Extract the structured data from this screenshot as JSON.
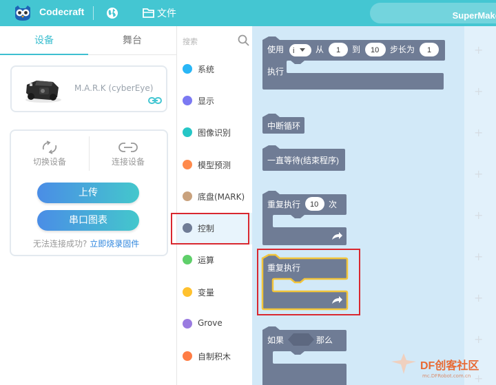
{
  "header": {
    "app_title": "Codecraft",
    "file_menu": "文件",
    "project_name": "SuperMaker",
    "bg_color": "#44c6d2"
  },
  "left_panel": {
    "tabs": [
      {
        "label": "设备",
        "active": true
      },
      {
        "label": "舞台",
        "active": false
      }
    ],
    "device": {
      "name": "M.A.R.K (cyberEye)"
    },
    "connection": {
      "switch_label": "切换设备",
      "connect_label": "连接设备",
      "upload_label": "上传",
      "serial_chart_label": "串口图表",
      "fail_text": "无法连接成功?",
      "flash_link": "立即烧录固件"
    }
  },
  "categories": {
    "search_placeholder": "搜索",
    "items": [
      {
        "label": "系统",
        "color": "#29b6f6"
      },
      {
        "label": "显示",
        "color": "#7b79f2"
      },
      {
        "label": "图像识别",
        "color": "#26c6c6"
      },
      {
        "label": "模型预测",
        "color": "#ff8a4c"
      },
      {
        "label": "底盘(MARK)",
        "color": "#c9a27e"
      },
      {
        "label": "控制",
        "color": "#6f7c95",
        "active": true
      },
      {
        "label": "运算",
        "color": "#5fcf6a"
      },
      {
        "label": "变量",
        "color": "#ffc12e"
      },
      {
        "label": "Grove",
        "color": "#9a7be0"
      },
      {
        "label": "自制积木",
        "color": "#ff7d45"
      }
    ]
  },
  "blocks": {
    "for_loop": {
      "use": "使用",
      "var": "i",
      "from": "从",
      "from_val": "1",
      "to": "到",
      "to_val": "10",
      "step": "步长为",
      "step_val": "1",
      "do": "执行"
    },
    "break_loop": "中断循环",
    "wait_forever": "一直等待(结束程序)",
    "repeat_n": {
      "label": "重复执行",
      "count": "10",
      "times": "次"
    },
    "repeat_forever": "重复执行",
    "if_then": {
      "if": "如果",
      "then": "那么"
    },
    "block_color": "#6f7c95"
  },
  "watermark": {
    "main": "DF创客社区",
    "sub": "mc.DFRobot.com.cn"
  }
}
